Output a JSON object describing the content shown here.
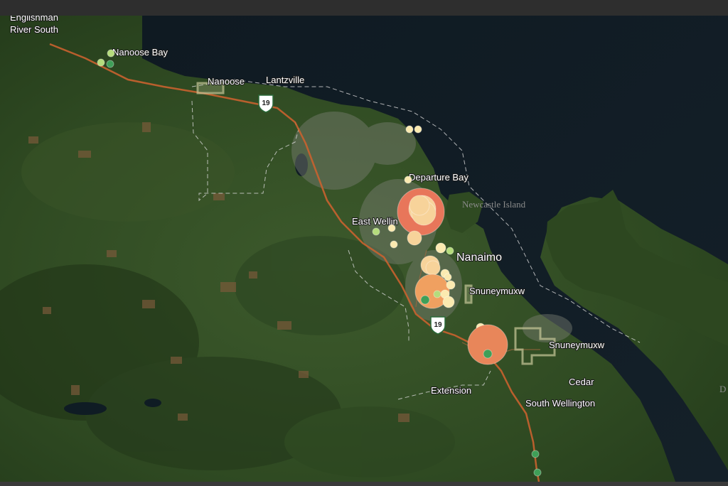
{
  "map": {
    "labels": {
      "englishman_line1": "Englishman",
      "englishman_line2": "River South",
      "nanoose_bay": "Nanoose Bay",
      "nanoose": "Nanoose",
      "lantzville": "Lantzville",
      "departure_bay": "Departure Bay",
      "east_wellington": "East Wellin",
      "nanaimo": "Nanaimo",
      "snuneymuxw_1": "Snuneymuxw",
      "snuneymuxw_2": "Snuneymuxw",
      "extension": "Extension",
      "cedar": "Cedar",
      "south_wellington": "South Wellington",
      "newcastle_island": "Newcastle Island",
      "edge_letter": "D"
    },
    "highway_shields": [
      "19",
      "19"
    ],
    "marker_colors": {
      "large": "#e8765a",
      "medium": "#f0a060",
      "light": "#f7d39a",
      "pale": "#fbeab0",
      "lime": "#b5dc7c",
      "green": "#3f9f58"
    }
  }
}
